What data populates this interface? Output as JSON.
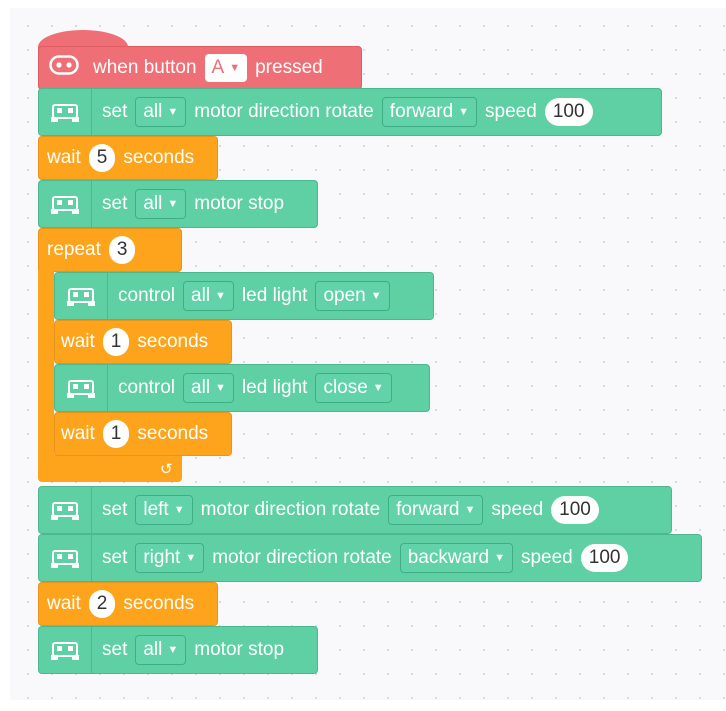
{
  "hat": {
    "prefix": "when button",
    "button_value": "A",
    "suffix": "pressed"
  },
  "blocks": {
    "b1": {
      "set": "set",
      "target": "all",
      "middle": "motor direction rotate",
      "direction": "forward",
      "speed_label": "speed",
      "speed": "100"
    },
    "b2": {
      "label": "wait",
      "value": "5",
      "unit": "seconds"
    },
    "b3": {
      "set": "set",
      "target": "all",
      "middle": "motor stop"
    },
    "b4": {
      "label": "repeat",
      "value": "3"
    },
    "b5": {
      "control": "control",
      "target": "all",
      "middle": "led light",
      "state": "open"
    },
    "b6": {
      "label": "wait",
      "value": "1",
      "unit": "seconds"
    },
    "b7": {
      "control": "control",
      "target": "all",
      "middle": "led light",
      "state": "close"
    },
    "b8": {
      "label": "wait",
      "value": "1",
      "unit": "seconds"
    },
    "b9": {
      "set": "set",
      "target": "left",
      "middle": "motor direction rotate",
      "direction": "forward",
      "speed_label": "speed",
      "speed": "100"
    },
    "b10": {
      "set": "set",
      "target": "right",
      "middle": "motor direction rotate",
      "direction": "backward",
      "speed_label": "speed",
      "speed": "100"
    },
    "b11": {
      "label": "wait",
      "value": "2",
      "unit": "seconds"
    },
    "b12": {
      "set": "set",
      "target": "all",
      "middle": "motor stop"
    }
  },
  "icons": {
    "car": "robot-car-icon",
    "button": "button-icon",
    "loop": "loop-arrow-icon",
    "caret": "caret-down-icon"
  },
  "colors": {
    "motion": "#5fd0a4",
    "control": "#fda41c",
    "event": "#ef6f76",
    "canvas": "#f9f9fb"
  }
}
